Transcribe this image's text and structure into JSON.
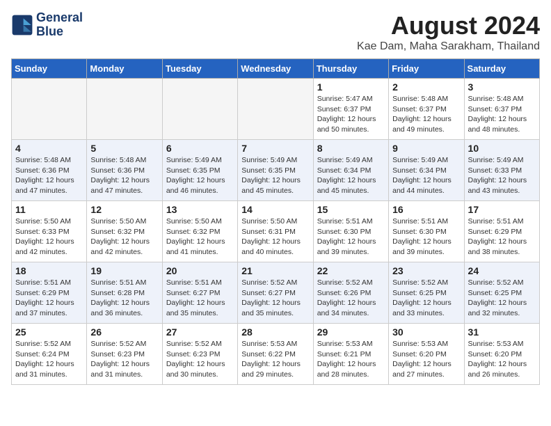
{
  "header": {
    "logo_line1": "General",
    "logo_line2": "Blue",
    "month": "August 2024",
    "location": "Kae Dam, Maha Sarakham, Thailand"
  },
  "days_of_week": [
    "Sunday",
    "Monday",
    "Tuesday",
    "Wednesday",
    "Thursday",
    "Friday",
    "Saturday"
  ],
  "weeks": [
    [
      {
        "day": "",
        "empty": true
      },
      {
        "day": "",
        "empty": true
      },
      {
        "day": "",
        "empty": true
      },
      {
        "day": "",
        "empty": true
      },
      {
        "day": "1",
        "sunrise": "5:47 AM",
        "sunset": "6:37 PM",
        "daylight": "12 hours and 50 minutes."
      },
      {
        "day": "2",
        "sunrise": "5:48 AM",
        "sunset": "6:37 PM",
        "daylight": "12 hours and 49 minutes."
      },
      {
        "day": "3",
        "sunrise": "5:48 AM",
        "sunset": "6:37 PM",
        "daylight": "12 hours and 48 minutes."
      }
    ],
    [
      {
        "day": "4",
        "sunrise": "5:48 AM",
        "sunset": "6:36 PM",
        "daylight": "12 hours and 47 minutes."
      },
      {
        "day": "5",
        "sunrise": "5:48 AM",
        "sunset": "6:36 PM",
        "daylight": "12 hours and 47 minutes."
      },
      {
        "day": "6",
        "sunrise": "5:49 AM",
        "sunset": "6:35 PM",
        "daylight": "12 hours and 46 minutes."
      },
      {
        "day": "7",
        "sunrise": "5:49 AM",
        "sunset": "6:35 PM",
        "daylight": "12 hours and 45 minutes."
      },
      {
        "day": "8",
        "sunrise": "5:49 AM",
        "sunset": "6:34 PM",
        "daylight": "12 hours and 45 minutes."
      },
      {
        "day": "9",
        "sunrise": "5:49 AM",
        "sunset": "6:34 PM",
        "daylight": "12 hours and 44 minutes."
      },
      {
        "day": "10",
        "sunrise": "5:49 AM",
        "sunset": "6:33 PM",
        "daylight": "12 hours and 43 minutes."
      }
    ],
    [
      {
        "day": "11",
        "sunrise": "5:50 AM",
        "sunset": "6:33 PM",
        "daylight": "12 hours and 42 minutes."
      },
      {
        "day": "12",
        "sunrise": "5:50 AM",
        "sunset": "6:32 PM",
        "daylight": "12 hours and 42 minutes."
      },
      {
        "day": "13",
        "sunrise": "5:50 AM",
        "sunset": "6:32 PM",
        "daylight": "12 hours and 41 minutes."
      },
      {
        "day": "14",
        "sunrise": "5:50 AM",
        "sunset": "6:31 PM",
        "daylight": "12 hours and 40 minutes."
      },
      {
        "day": "15",
        "sunrise": "5:51 AM",
        "sunset": "6:30 PM",
        "daylight": "12 hours and 39 minutes."
      },
      {
        "day": "16",
        "sunrise": "5:51 AM",
        "sunset": "6:30 PM",
        "daylight": "12 hours and 39 minutes."
      },
      {
        "day": "17",
        "sunrise": "5:51 AM",
        "sunset": "6:29 PM",
        "daylight": "12 hours and 38 minutes."
      }
    ],
    [
      {
        "day": "18",
        "sunrise": "5:51 AM",
        "sunset": "6:29 PM",
        "daylight": "12 hours and 37 minutes."
      },
      {
        "day": "19",
        "sunrise": "5:51 AM",
        "sunset": "6:28 PM",
        "daylight": "12 hours and 36 minutes."
      },
      {
        "day": "20",
        "sunrise": "5:51 AM",
        "sunset": "6:27 PM",
        "daylight": "12 hours and 35 minutes."
      },
      {
        "day": "21",
        "sunrise": "5:52 AM",
        "sunset": "6:27 PM",
        "daylight": "12 hours and 35 minutes."
      },
      {
        "day": "22",
        "sunrise": "5:52 AM",
        "sunset": "6:26 PM",
        "daylight": "12 hours and 34 minutes."
      },
      {
        "day": "23",
        "sunrise": "5:52 AM",
        "sunset": "6:25 PM",
        "daylight": "12 hours and 33 minutes."
      },
      {
        "day": "24",
        "sunrise": "5:52 AM",
        "sunset": "6:25 PM",
        "daylight": "12 hours and 32 minutes."
      }
    ],
    [
      {
        "day": "25",
        "sunrise": "5:52 AM",
        "sunset": "6:24 PM",
        "daylight": "12 hours and 31 minutes."
      },
      {
        "day": "26",
        "sunrise": "5:52 AM",
        "sunset": "6:23 PM",
        "daylight": "12 hours and 31 minutes."
      },
      {
        "day": "27",
        "sunrise": "5:52 AM",
        "sunset": "6:23 PM",
        "daylight": "12 hours and 30 minutes."
      },
      {
        "day": "28",
        "sunrise": "5:53 AM",
        "sunset": "6:22 PM",
        "daylight": "12 hours and 29 minutes."
      },
      {
        "day": "29",
        "sunrise": "5:53 AM",
        "sunset": "6:21 PM",
        "daylight": "12 hours and 28 minutes."
      },
      {
        "day": "30",
        "sunrise": "5:53 AM",
        "sunset": "6:20 PM",
        "daylight": "12 hours and 27 minutes."
      },
      {
        "day": "31",
        "sunrise": "5:53 AM",
        "sunset": "6:20 PM",
        "daylight": "12 hours and 26 minutes."
      }
    ]
  ],
  "labels": {
    "sunrise": "Sunrise:",
    "sunset": "Sunset:",
    "daylight": "Daylight:"
  }
}
